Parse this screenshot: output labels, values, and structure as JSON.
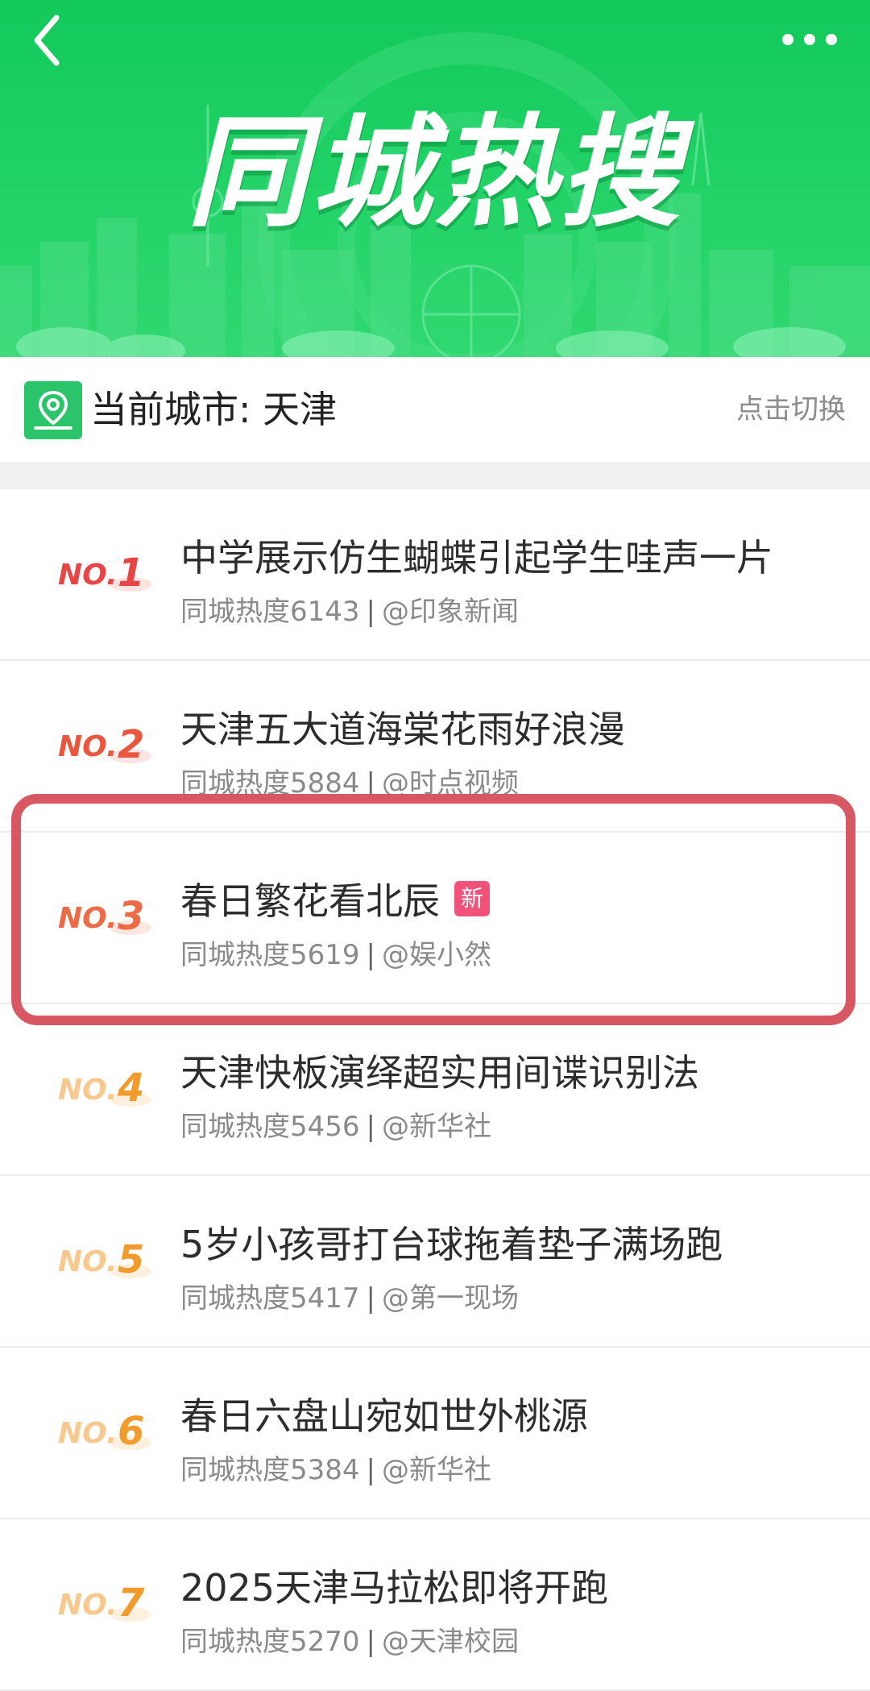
{
  "banner": {
    "title": "同城热搜",
    "bg_color": "#1fcf63"
  },
  "city": {
    "label": "当前城市: 天津",
    "switch_label": "点击切换",
    "icon": "location-pin-icon"
  },
  "list": {
    "items": [
      {
        "rank": "NO.",
        "num": "1",
        "title": "中学展示仿生蝴蝶引起学生哇声一片",
        "heat": "同城热度6143",
        "sep": "|",
        "source": "@印象新闻",
        "badge": "",
        "rank_color": "#e64646"
      },
      {
        "rank": "NO.",
        "num": "2",
        "title": "天津五大道海棠花雨好浪漫",
        "heat": "同城热度5884",
        "sep": "|",
        "source": "@时点视频",
        "badge": "",
        "rank_color": "#e9573f"
      },
      {
        "rank": "NO.",
        "num": "3",
        "title": "春日繁花看北辰",
        "heat": "同城热度5619",
        "sep": "|",
        "source": "@娱小然",
        "badge": "新",
        "rank_color": "#ec6a45"
      },
      {
        "rank": "NO.",
        "num": "4",
        "title": "天津快板演绎超实用间谍识别法",
        "heat": "同城热度5456",
        "sep": "|",
        "source": "@新华社",
        "badge": "",
        "rank_color": "#f39a2c"
      },
      {
        "rank": "NO.",
        "num": "5",
        "title": "5岁小孩哥打台球拖着垫子满场跑",
        "heat": "同城热度5417",
        "sep": "|",
        "source": "@第一现场",
        "badge": "",
        "rank_color": "#f39a2c"
      },
      {
        "rank": "NO.",
        "num": "6",
        "title": "春日六盘山宛如世外桃源",
        "heat": "同城热度5384",
        "sep": "|",
        "source": "@新华社",
        "badge": "",
        "rank_color": "#f39a2c"
      },
      {
        "rank": "NO.",
        "num": "7",
        "title": "2025天津马拉松即将开跑",
        "heat": "同城热度5270",
        "sep": "|",
        "source": "@天津校园",
        "badge": "",
        "rank_color": "#f39a2c"
      }
    ]
  },
  "highlight_color": "#d75762"
}
